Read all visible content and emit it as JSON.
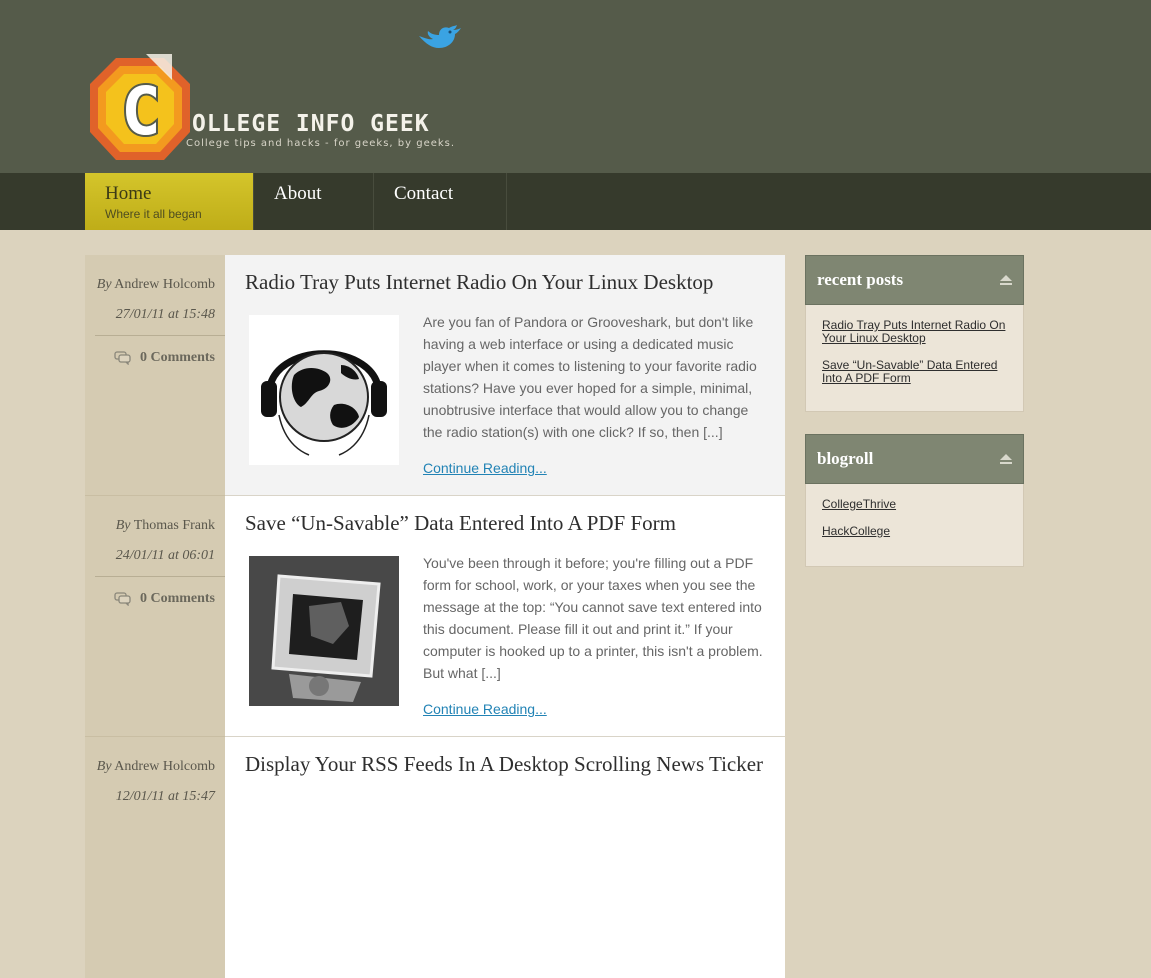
{
  "header": {
    "site_title": "OLLEGE INFO GEEK",
    "logo_letter": "C",
    "tagline": "College tips and hacks - for geeks, by geeks."
  },
  "nav": [
    {
      "label": "Home",
      "sublabel": "Where it all began",
      "active": true
    },
    {
      "label": "About",
      "sublabel": "",
      "active": false
    },
    {
      "label": "Contact",
      "sublabel": "",
      "active": false
    }
  ],
  "posts": [
    {
      "by": "By",
      "author": "Andrew Holcomb",
      "date": "27/01/11 at 15:48",
      "comments": "0 Comments",
      "title": "Radio Tray Puts Internet Radio On Your Linux Desktop",
      "excerpt": "Are you fan of Pandora or Grooveshark, but don't like having a web interface or using a dedicated music player when it comes to listening to your favorite radio stations? Have you ever hoped for a simple, minimal, unobtrusive interface that would allow you to change the radio station(s) with one click? If so, then [...]",
      "more": "Continue Reading..."
    },
    {
      "by": "By",
      "author": "Thomas Frank",
      "date": "24/01/11 at 06:01",
      "comments": "0 Comments",
      "title": "Save “Un-Savable” Data Entered Into A PDF Form",
      "excerpt": "You've been through it before; you're filling out a PDF form for school, work, or your taxes when you see the message at the top: “You cannot save text entered into this document. Please fill it out and print it.” If your computer is hooked up to a printer, this isn't a problem. But what [...]",
      "more": "Continue Reading..."
    },
    {
      "by": "By",
      "author": "Andrew Holcomb",
      "date": "12/01/11 at 15:47",
      "comments": "",
      "title": "Display Your RSS Feeds In A Desktop Scrolling News Ticker",
      "excerpt": "",
      "more": ""
    }
  ],
  "sidebar": {
    "recent": {
      "title": "recent posts",
      "links": [
        "Radio Tray Puts Internet Radio On Your Linux Desktop",
        "Save “Un-Savable” Data Entered Into A PDF Form"
      ]
    },
    "blogroll": {
      "title": "blogroll",
      "links": [
        "CollegeThrive",
        "HackCollege"
      ]
    }
  },
  "colors": {
    "header_bg": "#555b4a",
    "nav_bg": "#363a2c",
    "nav_active": "#c9b820",
    "link": "#2283b5",
    "page_bg": "#dcd3be"
  }
}
